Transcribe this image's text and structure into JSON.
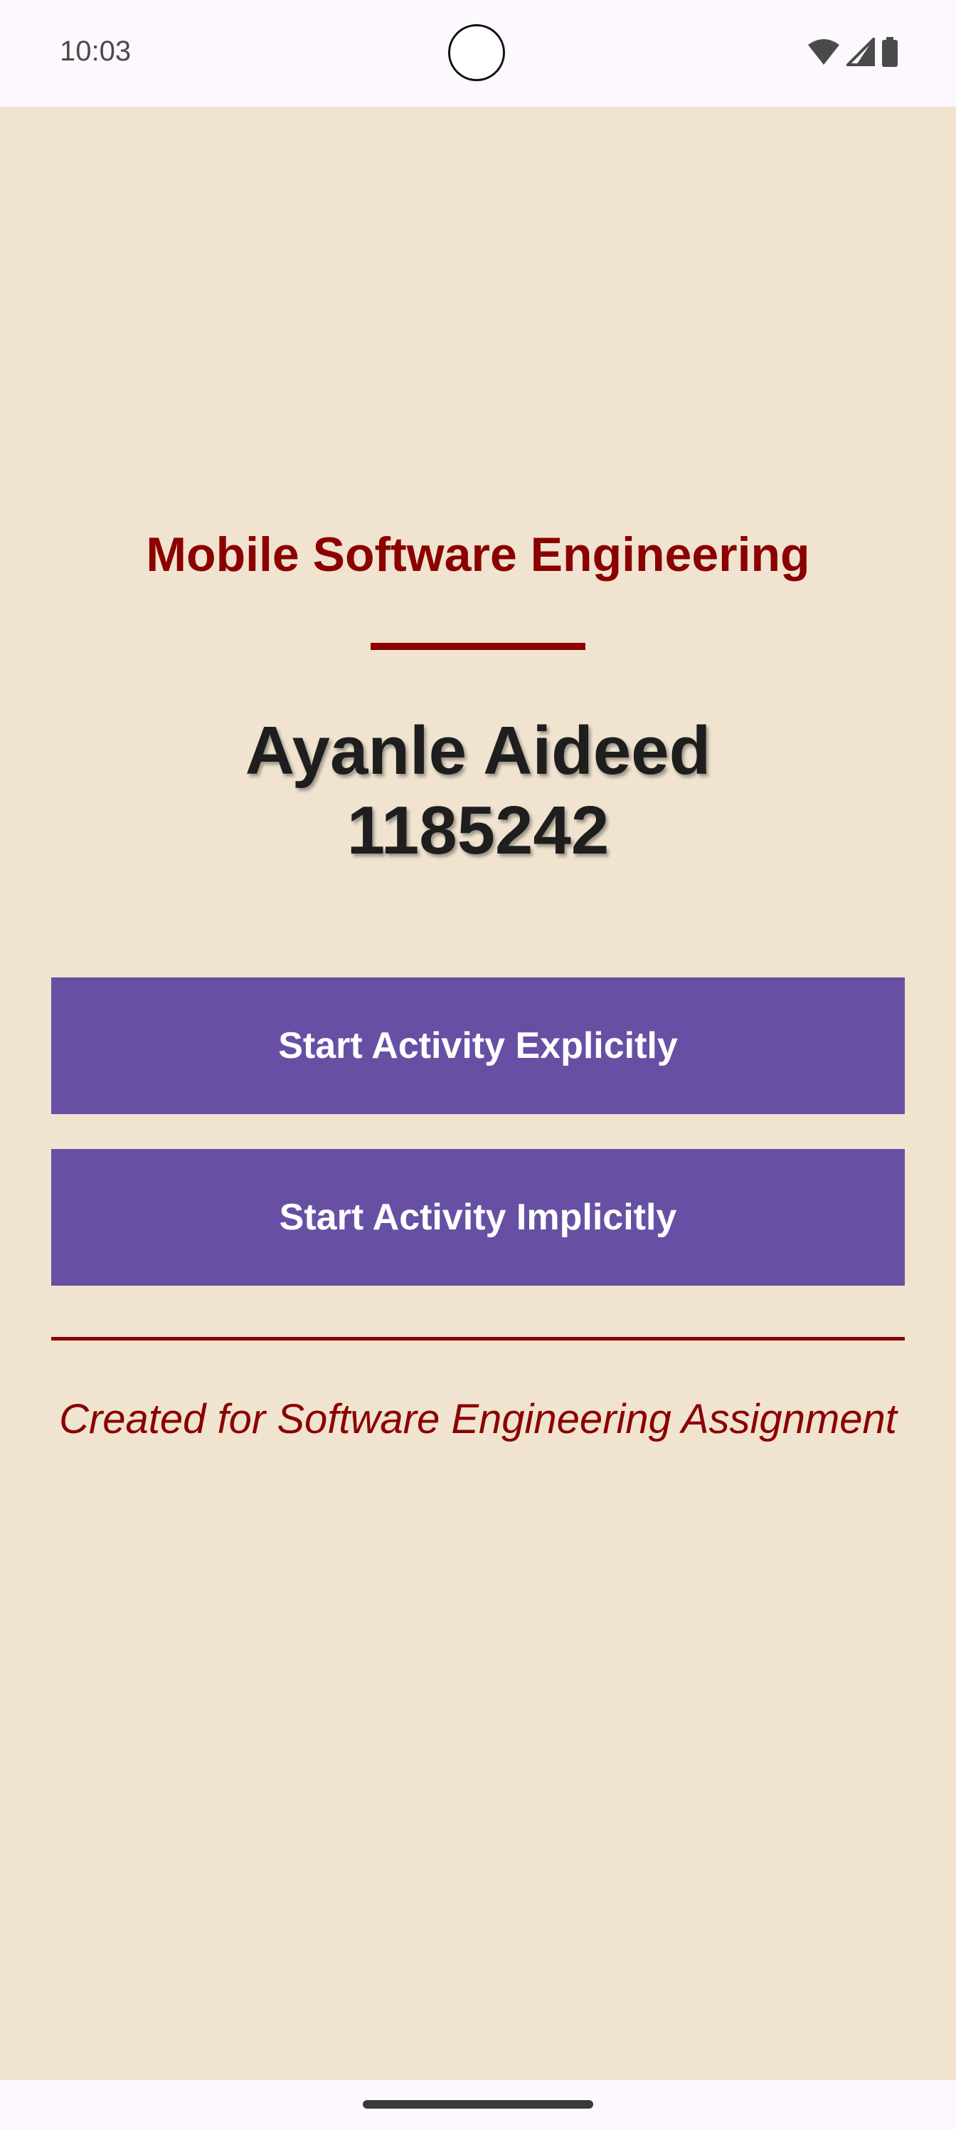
{
  "status_bar": {
    "time": "10:03",
    "icons": [
      "wifi-icon",
      "cellular-signal-icon",
      "battery-icon"
    ]
  },
  "main": {
    "subject_title": "Mobile Software Engineering",
    "student_name": "Ayanle Aideed",
    "student_id": "1185242",
    "buttons": {
      "explicit_label": "Start Activity Explicitly",
      "implicit_label": "Start Activity Implicitly"
    },
    "footer_note": "Created for Software Engineering Assignment"
  },
  "colors": {
    "background": "#f0e4d0",
    "accent": "#8b0000",
    "button": "#6750a4",
    "button_text": "#ffffff",
    "name_text": "#1e1e1e"
  }
}
